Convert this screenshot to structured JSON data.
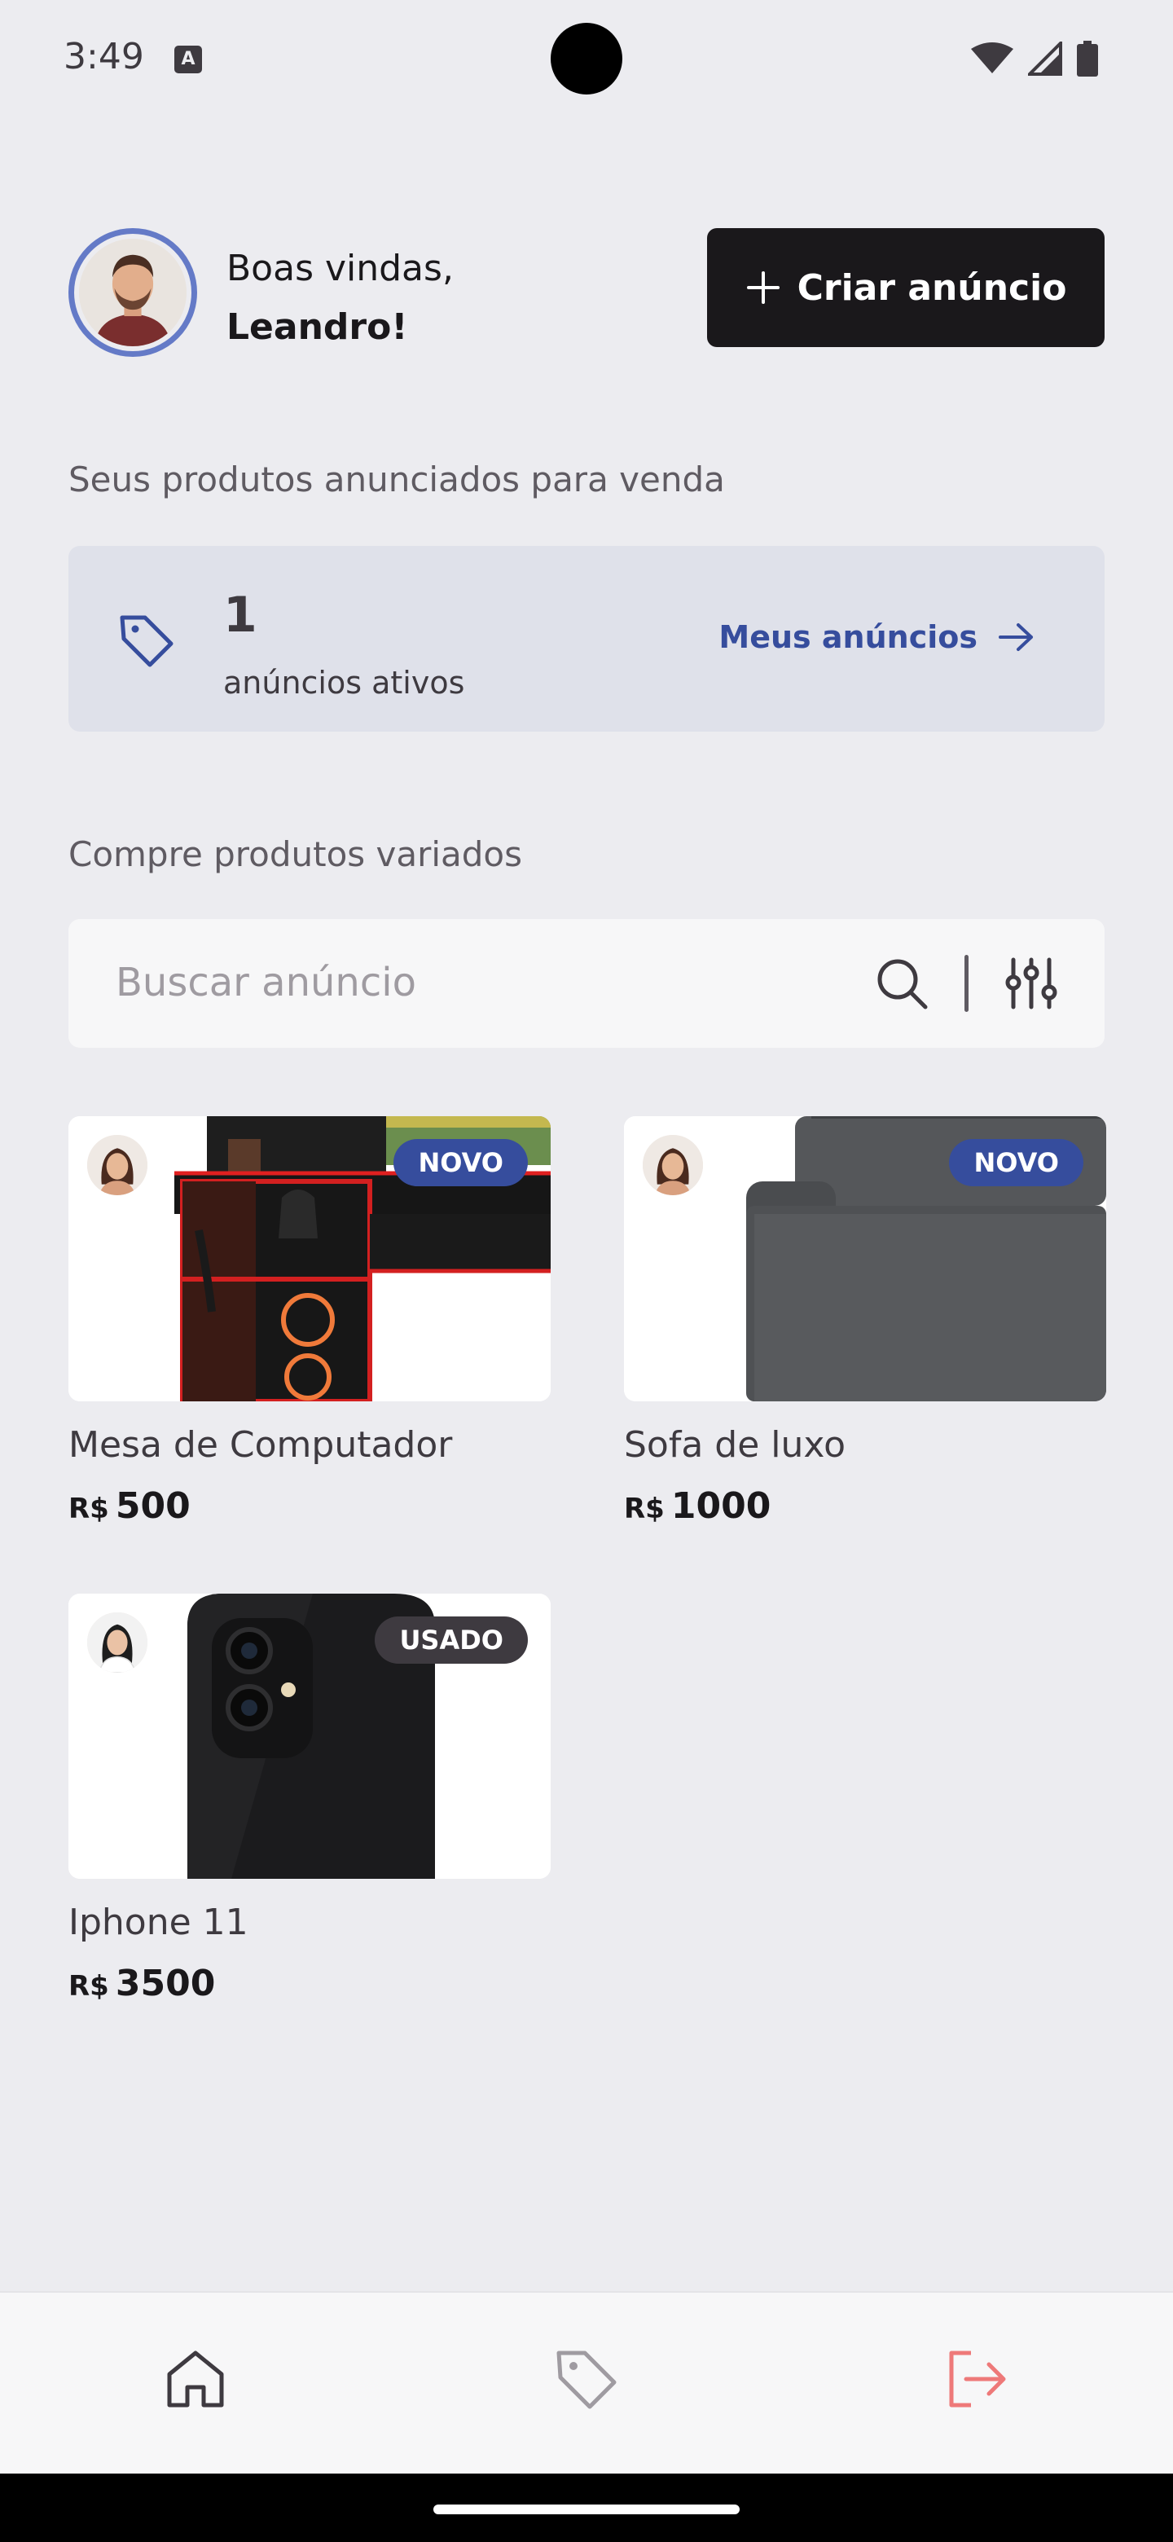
{
  "status_bar": {
    "time": "3:49"
  },
  "header": {
    "greeting": "Boas vindas,",
    "user_name": "Leandro!",
    "create_button": "Criar anúncio"
  },
  "my_ads": {
    "section_label": "Seus produtos anunciados para venda",
    "count": "1",
    "count_label": "anúncios ativos",
    "link": "Meus anúncios"
  },
  "browse": {
    "section_label": "Compre produtos variados",
    "search_placeholder": "Buscar anúncio"
  },
  "products": [
    {
      "name": "Mesa de Computador",
      "currency": "R$",
      "price": "500",
      "badge": "NOVO"
    },
    {
      "name": "Sofa de luxo",
      "currency": "R$",
      "price": "1000",
      "badge": "NOVO"
    },
    {
      "name": "Iphone 11",
      "currency": "R$",
      "price": "3500",
      "badge": "USADO"
    }
  ],
  "bottom_nav": [
    "home-icon",
    "tag-icon",
    "sign-out-icon"
  ],
  "colors": {
    "brand": "#364D9D",
    "dark": "#1A181B",
    "danger": "#EE7979",
    "avatar_ring": "#647AC7"
  }
}
